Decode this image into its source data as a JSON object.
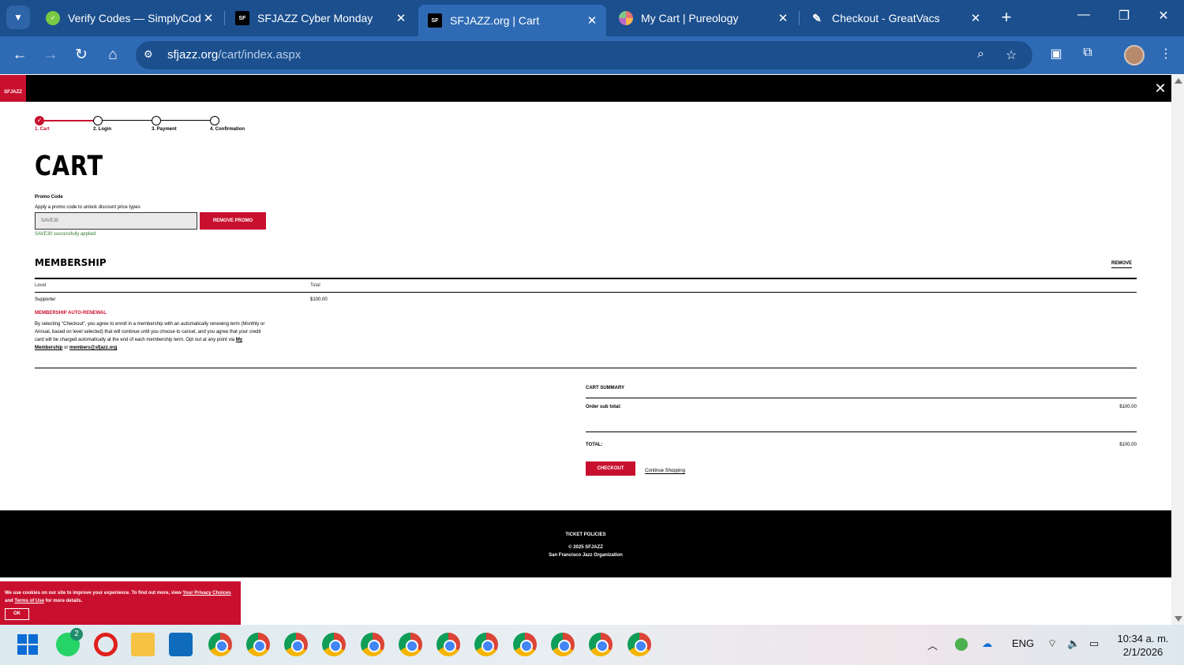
{
  "browser": {
    "tabs": [
      {
        "title": "Verify Codes — SimplyCodes",
        "active": false
      },
      {
        "title": "SFJAZZ Cyber Monday",
        "active": false
      },
      {
        "title": "SFJAZZ.org | Cart",
        "active": true
      },
      {
        "title": "My Cart | Pureology",
        "active": false
      },
      {
        "title": "Checkout - GreatVacs",
        "active": false
      }
    ],
    "url_host": "sfjazz.org",
    "url_path": "/cart/index.aspx"
  },
  "page": {
    "logo_text": "SFJAZZ",
    "steps": [
      {
        "label": "1. Cart",
        "active": true
      },
      {
        "label": "2. Login",
        "active": false
      },
      {
        "label": "3. Payment",
        "active": false
      },
      {
        "label": "4. Confirmation",
        "active": false
      }
    ],
    "title": "CART",
    "promo": {
      "label": "Promo Code",
      "help": "Apply a promo code to unlock discount price types",
      "value": "SAVE30",
      "button": "REMOVE PROMO",
      "success": "SAVE30 successfully applied"
    },
    "membership": {
      "title": "MEMBERSHIP",
      "remove": "REMOVE",
      "col_level": "Level",
      "col_total": "Total",
      "level": "Supporter",
      "total": "$100.00",
      "renewal_title": "MEMBERSHIP AUTO-RENEWAL",
      "renewal_text": "By selecting \"Checkout\", you agree to enroll in a membership with an automatically renewing term (Monthly or Annual, based on level selected) that will continue until you choose to cancel, and you agree that your credit card will be charged automatically at the end of each membership term. Opt out at any point via",
      "renewal_link1": "My Membership",
      "renewal_or": "or",
      "renewal_link2": "members@sfjazz.org"
    },
    "summary": {
      "title": "CART SUMMARY",
      "subtotal_label": "Order sub total:",
      "subtotal_value": "$100.00",
      "total_label": "TOTAL:",
      "total_value": "$100.00",
      "checkout": "CHECKOUT",
      "continue": "Continue Shopping"
    },
    "footer": {
      "policies": "TICKET POLICIES",
      "copyright": "© 2025 SFJAZZ",
      "org": "San Francisco Jazz Organization"
    },
    "cookie": {
      "text_a": "We use cookies on our site to improve your experience. To find out more, view",
      "link_a": "Your Privacy Choices",
      "text_b": "and",
      "link_b": "Terms of Use",
      "text_c": "for more details.",
      "ok": "OK"
    }
  },
  "taskbar": {
    "whatsapp_badge": "2",
    "lang": "ENG",
    "time": "10:34 a. m.",
    "date": "2/1/2026"
  },
  "colors": {
    "brand_red": "#c8102e",
    "chrome_blue": "#2f6bb5",
    "success_green": "#2e7d32"
  }
}
